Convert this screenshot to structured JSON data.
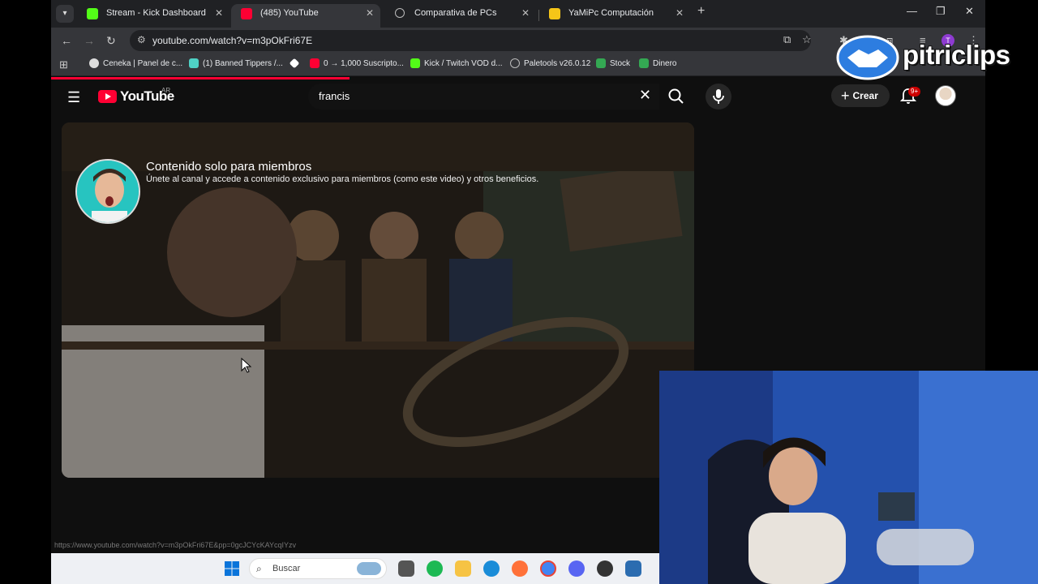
{
  "browser": {
    "tabs": [
      {
        "title": "Stream - Kick Dashboard",
        "icon": "kick-icon",
        "color": "#53fc18"
      },
      {
        "title": "(485) YouTube",
        "icon": "youtube-icon",
        "color": "#ff0033",
        "active": true
      },
      {
        "title": "Comparativa de PCs",
        "icon": "globe-icon",
        "color": "#bbbbbb"
      },
      {
        "title": "YaMiPc Computación",
        "icon": "yamipc-icon",
        "color": "#f5c518"
      }
    ],
    "url": "youtube.com/watch?v=m3pOkFri67E",
    "profile_initial": "T",
    "bookmarks": [
      {
        "label": "Ceneka | Panel de c...",
        "icon": "chrome-icon"
      },
      {
        "label": "(1) Banned Tippers /...",
        "icon": "twitch-icon"
      },
      {
        "label": "",
        "icon": "diamond-icon"
      },
      {
        "label": "0 → 1,000 Suscripto...",
        "icon": "youtube-icon"
      },
      {
        "label": "Kick / Twitch VOD d...",
        "icon": "d-icon"
      },
      {
        "label": "Paletools v26.0.12",
        "icon": "globe-icon"
      },
      {
        "label": "Stock",
        "icon": "sheets-icon"
      },
      {
        "label": "Dinero",
        "icon": "sheets-icon"
      }
    ]
  },
  "youtube": {
    "logo_text": "YouTube",
    "country_code": "AR",
    "search_query": "francis",
    "create_label": "Crear",
    "notifications_badge": "9+",
    "members_title": "Contenido solo para miembros",
    "members_desc": "Únete al canal y accede a contenido exclusivo para miembros (como este video) y otros beneficios."
  },
  "status_url": "https://www.youtube.com/watch?v=m3pOkFri67E&pp=0gcJCYcKAYcqIYzv",
  "taskbar": {
    "search_label": "Buscar"
  },
  "overlay": {
    "brand_name": "pitriclips"
  }
}
